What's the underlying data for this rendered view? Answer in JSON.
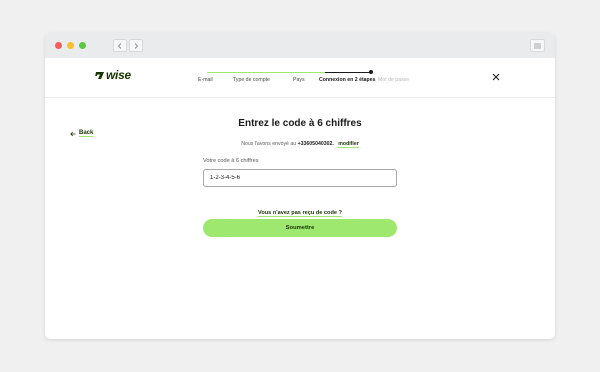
{
  "header": {
    "logo_text": "wise",
    "steps": [
      {
        "label": "E-mail",
        "state": "done"
      },
      {
        "label": "Type de compte",
        "state": "done"
      },
      {
        "label": "Pays",
        "state": "done"
      },
      {
        "label": "Connexion en 2 étapes",
        "state": "current"
      },
      {
        "label": "Mot de passe",
        "state": "future"
      }
    ]
  },
  "nav": {
    "back_label": "Back"
  },
  "main": {
    "title": "Entrez le code à 6 chiffres",
    "sent_prefix": "Nous l'avons envoyé au",
    "phone": "+33605040302.",
    "modify_label": "modifier",
    "field_label": "Votre code à 6 chiffres",
    "code_value": "1-2-3-4-5-6",
    "resend_label": "Vous n'avez pas reçu de code ?",
    "submit_label": "Soumettre"
  },
  "colors": {
    "brand_green": "#9fe870",
    "brand_dark": "#163300"
  }
}
